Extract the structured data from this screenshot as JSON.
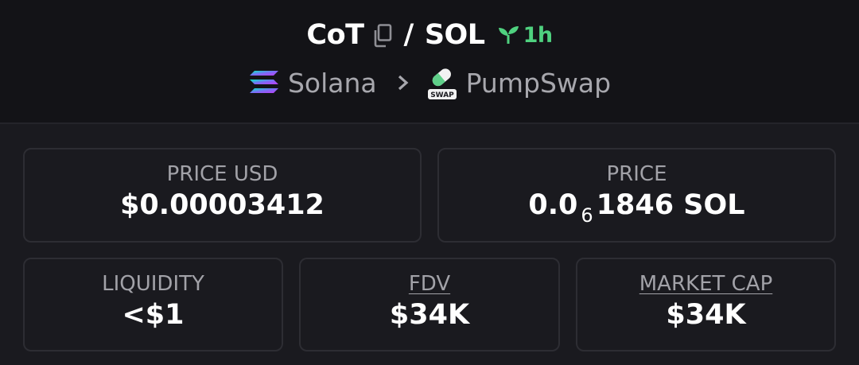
{
  "pair": {
    "base_symbol": "CoT",
    "separator": "/",
    "quote_symbol": "SOL",
    "age": "1h"
  },
  "route": {
    "chain": "Solana",
    "dex": "PumpSwap",
    "dex_badge": "SWAP"
  },
  "stats": {
    "price_usd": {
      "label": "PRICE USD",
      "value": "$0.00003412"
    },
    "price_native": {
      "label": "PRICE",
      "prefix": "0.0",
      "subscript": "6",
      "suffix": "1846 SOL"
    },
    "liquidity": {
      "label": "LIQUIDITY",
      "value": "<$1"
    },
    "fdv": {
      "label": "FDV",
      "value": "$34K"
    },
    "market_cap": {
      "label": "MARKET CAP",
      "value": "$34K"
    }
  },
  "colors": {
    "background": "#1a1a1f",
    "header_background": "#131317",
    "accent_green": "#4fd17f",
    "muted_text": "#a2a2a8",
    "card_border": "#2d2d33"
  },
  "icons": [
    "copy-icon",
    "sprout-icon",
    "solana-logo",
    "chevron-right-icon",
    "pumpswap-logo"
  ]
}
